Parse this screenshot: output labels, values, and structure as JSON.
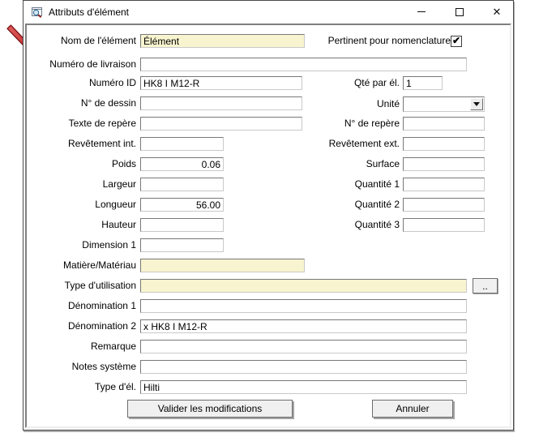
{
  "title_bar": {
    "title": "Attributs d'élément",
    "close_glyph": "✕"
  },
  "fields": {
    "nom": {
      "label": "Nom de l'élément",
      "value": "Élément"
    },
    "pertinent": {
      "label": "Pertinent pour nomenclature",
      "checked_attr": "checked",
      "check_glyph": "✔"
    },
    "livraison": {
      "label": "Numéro de livraison",
      "value": ""
    },
    "numero_id": {
      "label": "Numéro ID",
      "value": "HK8 I M12-R"
    },
    "qte_par_el": {
      "label": "Qté par él.",
      "value": "1"
    },
    "dessin": {
      "label": "N° de dessin",
      "value": ""
    },
    "unite": {
      "label": "Unité",
      "value": ""
    },
    "texte_repere": {
      "label": "Texte de repère",
      "value": ""
    },
    "n_repere": {
      "label": "N° de repère",
      "value": ""
    },
    "revetement_int": {
      "label": "Revêtement int.",
      "value": ""
    },
    "revetement_ext": {
      "label": "Revêtement ext.",
      "value": ""
    },
    "poids": {
      "label": "Poids",
      "value": "0.06"
    },
    "surface": {
      "label": "Surface",
      "value": ""
    },
    "largeur": {
      "label": "Largeur",
      "value": ""
    },
    "quantite_1": {
      "label": "Quantité 1",
      "value": ""
    },
    "longueur": {
      "label": "Longueur",
      "value": "56.00"
    },
    "quantite_2": {
      "label": "Quantité 2",
      "value": ""
    },
    "hauteur": {
      "label": "Hauteur",
      "value": ""
    },
    "quantite_3": {
      "label": "Quantité 3",
      "value": ""
    },
    "dimension_1": {
      "label": "Dimension 1",
      "value": ""
    },
    "matiere": {
      "label": "Matière/Matériau",
      "value": ""
    },
    "type_utilisation": {
      "label": "Type d'utilisation",
      "value": "",
      "browse_label": ".."
    },
    "denomination_1": {
      "label": "Dénomination 1",
      "value": ""
    },
    "denomination_2": {
      "label": "Dénomination 2",
      "value": "x HK8 I M12-R"
    },
    "remarque": {
      "label": "Remarque",
      "value": ""
    },
    "notes_systeme": {
      "label": "Notes système",
      "value": ""
    },
    "type_el": {
      "label": "Type d'él.",
      "value": "Hilti"
    }
  },
  "buttons": {
    "validate": "Valider les modifications",
    "cancel": "Annuler"
  },
  "colors": {
    "highlight_field": "#f7f4cf",
    "arrow_red": "#c0392b"
  }
}
